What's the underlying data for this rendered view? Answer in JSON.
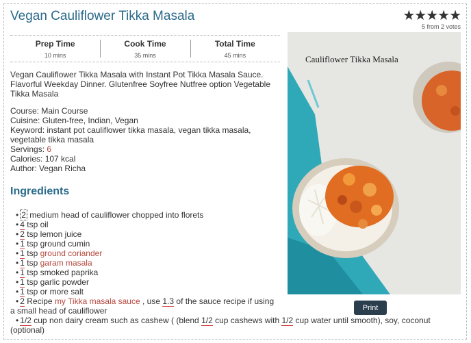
{
  "recipe": {
    "title": "Vegan Cauliflower Tikka Masala",
    "rating": {
      "stars": "★★★★★",
      "votes_text": "5 from 2 votes",
      "value": 5,
      "max": 5
    },
    "times": [
      {
        "label": "Prep Time",
        "value": "10 mins"
      },
      {
        "label": "Cook Time",
        "value": "35 mins"
      },
      {
        "label": "Total Time",
        "value": "45 mins"
      }
    ],
    "summary": "Vegan Cauliflower Tikka Masala with Instant Pot Tikka Masala Sauce. Flavorful Weekday Dinner. Glutenfree Soyfree Nutfree option Vegetable Tikka Masala",
    "meta": {
      "course_label": "Course:",
      "course": "Main Course",
      "cuisine_label": "Cuisine:",
      "cuisine": "Gluten-free, Indian, Vegan",
      "keyword_label": "Keyword:",
      "keyword": "instant pot cauliflower tikka masala, vegan tikka masala, vegetable tikka masala",
      "servings_label": "Servings:",
      "servings": "6",
      "calories_label": "Calories:",
      "calories": "107 kcal",
      "author_label": "Author:",
      "author": "Vegan Richa"
    },
    "ingredients_heading": "Ingredients",
    "ingredients": [
      {
        "qty": "2",
        "unit": "",
        "name": "medium head of cauliflower chopped into florets"
      },
      {
        "qty": "4",
        "unit": "tsp",
        "name": "oil"
      },
      {
        "qty": "2",
        "unit": "tsp",
        "name": "lemon juice"
      },
      {
        "qty": "1",
        "unit": "tsp",
        "name": "ground cumin"
      },
      {
        "qty": "1",
        "unit": "tsp",
        "name": "ground coriander"
      },
      {
        "qty": "1",
        "unit": "tsp",
        "name": "garam masala"
      },
      {
        "qty": "1",
        "unit": "tsp",
        "name": "smoked paprika"
      },
      {
        "qty": "1",
        "unit": "tsp",
        "name": "garlic powder"
      },
      {
        "qty": "1",
        "unit": "tsp",
        "name": "or more salt"
      },
      {
        "qty": "2",
        "unit": "Recipe",
        "link": "my Tikka masala sauce",
        "pre": ", use",
        "qty2": "1.3",
        "post": "of the sauce recipe if using a small head of cauliflower"
      },
      {
        "qty": "1/2",
        "unit": "cup",
        "pre": "non dairy cream such as cashew ( (blend",
        "qty2": "1/2",
        "mid": "cup cashews with",
        "qty3": "1/2",
        "post": "cup water until smooth), soy, coconut (optional)"
      }
    ],
    "image": {
      "caption": "Cauliflower Tikka Masala"
    },
    "print_label": "Print"
  }
}
